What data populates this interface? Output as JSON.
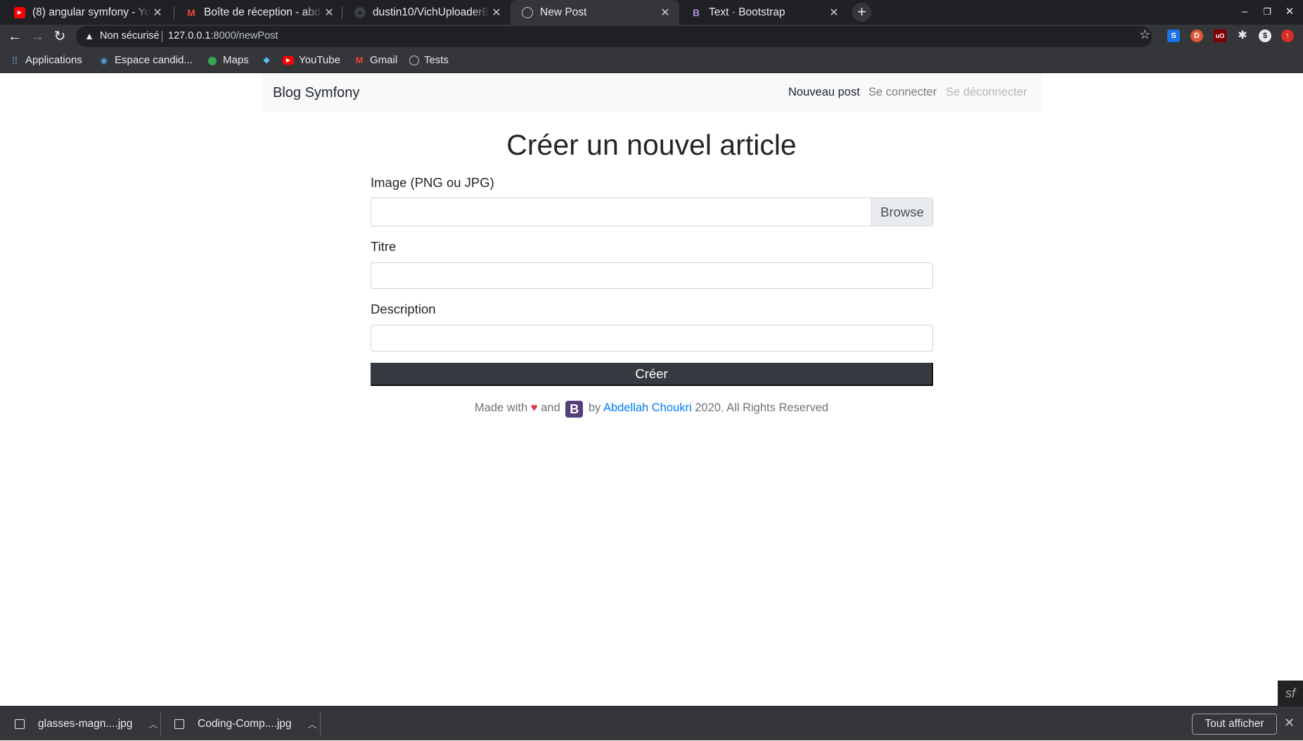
{
  "browser": {
    "tabs": [
      {
        "title": "(8) angular symfony - YouTube",
        "icon": "youtube-icon",
        "active": false
      },
      {
        "title": "Boîte de réception - abdellah",
        "icon": "gmail-icon",
        "active": false
      },
      {
        "title": "dustin10/VichUploaderBundle",
        "icon": "github-icon",
        "active": false
      },
      {
        "title": "New Post",
        "icon": "globe-icon",
        "active": true
      },
      {
        "title": "Text · Bootstrap",
        "icon": "bootstrap-icon",
        "active": false
      }
    ],
    "address": {
      "security": "Non sécurisé",
      "host": "127.0.0.1",
      "path": ":8000/newPost"
    },
    "bookmarks": [
      {
        "label": "Applications",
        "icon": "apps-grid-icon"
      },
      {
        "label": "Espace candid...",
        "icon": "espace-icon"
      },
      {
        "label": "Maps",
        "icon": "maps-icon"
      },
      {
        "label": "",
        "icon": "diamond-icon"
      },
      {
        "label": "YouTube",
        "icon": "youtube-icon"
      },
      {
        "label": "Gmail",
        "icon": "gmail-icon"
      },
      {
        "label": "Tests",
        "icon": "globe-icon"
      }
    ]
  },
  "page": {
    "brand": "Blog Symfony",
    "nav": {
      "new_post": "Nouveau post",
      "login": "Se connecter",
      "logout": "Se déconnecter"
    },
    "title": "Créer un nouvel article",
    "form": {
      "image_label": "Image (PNG ou JPG)",
      "browse": "Browse",
      "title_label": "Titre",
      "description_label": "Description",
      "submit": "Créer"
    },
    "footer": {
      "made_with": "Made with",
      "and": "and",
      "bootstrap_letter": "B",
      "by": "by",
      "author": "Abdellah Choukri",
      "rights": "2020. All Rights Reserved"
    }
  },
  "downloads": {
    "items": [
      "glasses-magn....jpg",
      "Coding-Comp....jpg"
    ],
    "show_all": "Tout afficher"
  },
  "colors": {
    "accent_link": "#007bff",
    "button_dark": "#343a40",
    "heart": "#dc3545",
    "bootstrap_purple": "#563d7c"
  }
}
